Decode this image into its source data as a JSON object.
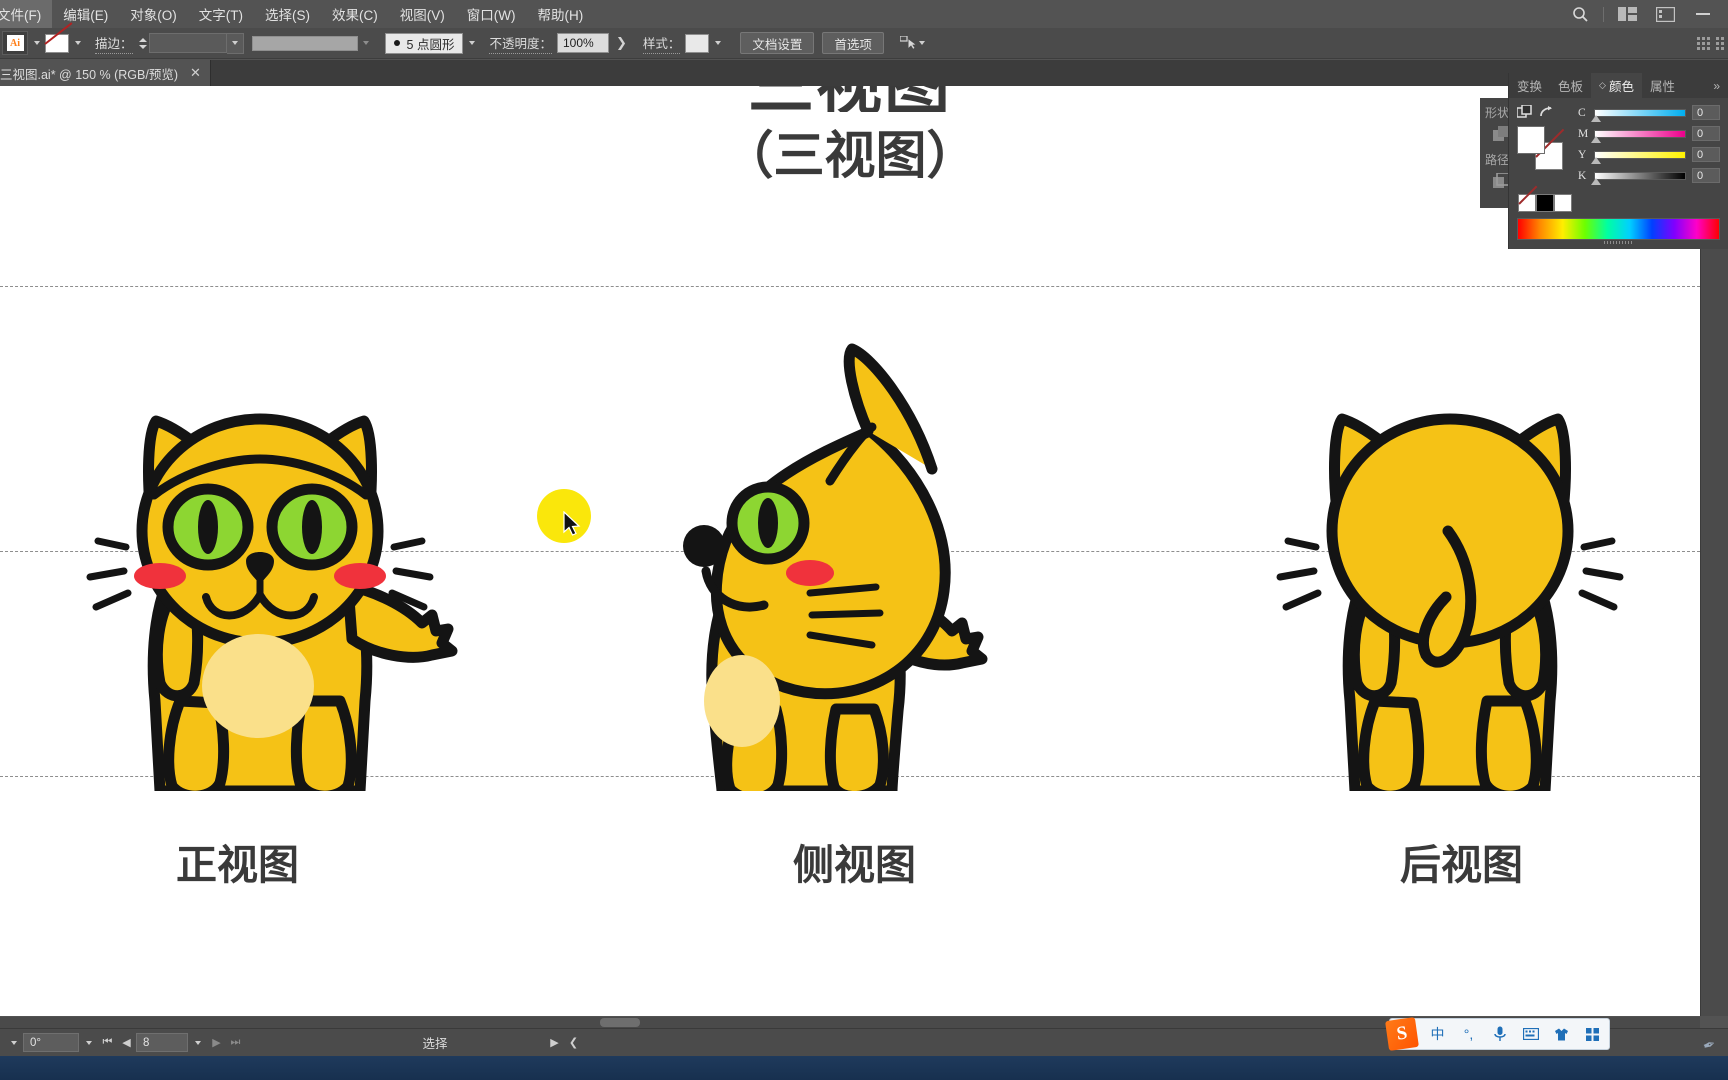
{
  "app": {
    "name": "Adobe Illustrator",
    "logo_letters": "Ai"
  },
  "menubar": {
    "items": [
      {
        "label": "文件(F)"
      },
      {
        "label": "编辑(E)"
      },
      {
        "label": "对象(O)"
      },
      {
        "label": "文字(T)"
      },
      {
        "label": "选择(S)"
      },
      {
        "label": "效果(C)"
      },
      {
        "label": "视图(V)"
      },
      {
        "label": "窗口(W)"
      },
      {
        "label": "帮助(H)"
      }
    ],
    "right_icons": [
      {
        "name": "search-icon",
        "glyph": "⌕"
      },
      {
        "name": "arrange-documents-icon",
        "glyph": "▤"
      },
      {
        "name": "workspace-switcher-icon",
        "glyph": "▣"
      }
    ]
  },
  "controlbar": {
    "fill_label": "",
    "stroke_label": "描边：",
    "stroke_weight": "",
    "brush_definition": "5 点圆形",
    "opacity_label": "不透明度：",
    "opacity_value": "100%",
    "style_label": "样式：",
    "document_setup_button": "文档设置",
    "preferences_button": "首选项",
    "align_icon_name": "align-objects-icon"
  },
  "tabbar": {
    "document_tab": "三视图.ai* @ 150 % (RGB/预览)",
    "close_glyph": "✕"
  },
  "canvas": {
    "title": "三视图",
    "subtitle": "（三视图）",
    "view_labels": [
      {
        "label": "正视图"
      },
      {
        "label": "侧视图"
      },
      {
        "label": "后视图"
      }
    ],
    "selection_dot_color": "#FAE70B",
    "colors": {
      "cat_body": "#F5C216",
      "cat_belly": "#FAE08A",
      "cat_eye": "#8DD632",
      "cat_cheek": "#F0323C",
      "cat_outline": "#141414"
    }
  },
  "right_panel": {
    "tabs": [
      {
        "label": "变换",
        "active": false
      },
      {
        "label": "色板",
        "active": false
      },
      {
        "label": "颜色",
        "active": true
      },
      {
        "label": "属性",
        "active": false
      }
    ],
    "more_glyph": "»",
    "color": {
      "sliders": [
        {
          "label": "C",
          "value": "0"
        },
        {
          "label": "M",
          "value": "0"
        },
        {
          "label": "Y",
          "value": "0"
        },
        {
          "label": "K",
          "value": "0"
        }
      ]
    }
  },
  "sub_panel": {
    "shape_label": "形状",
    "path_label": "路径"
  },
  "statusbar": {
    "rotation": "0°",
    "artboard_number": "8",
    "status_text": "选择",
    "nav_first_glyph": "⏮",
    "nav_prev_glyph": "◀",
    "nav_next_glyph": "▶",
    "nav_last_glyph": "⏭"
  },
  "ime": {
    "logo": "S",
    "mode": "中",
    "items": [
      {
        "name": "punctuation-icon",
        "glyph": "°,"
      },
      {
        "name": "microphone-icon",
        "glyph": "🎤"
      },
      {
        "name": "keyboard-icon",
        "glyph": "⌨"
      },
      {
        "name": "skin-icon",
        "glyph": "👕"
      },
      {
        "name": "apps-icon",
        "glyph": "▦"
      }
    ]
  }
}
